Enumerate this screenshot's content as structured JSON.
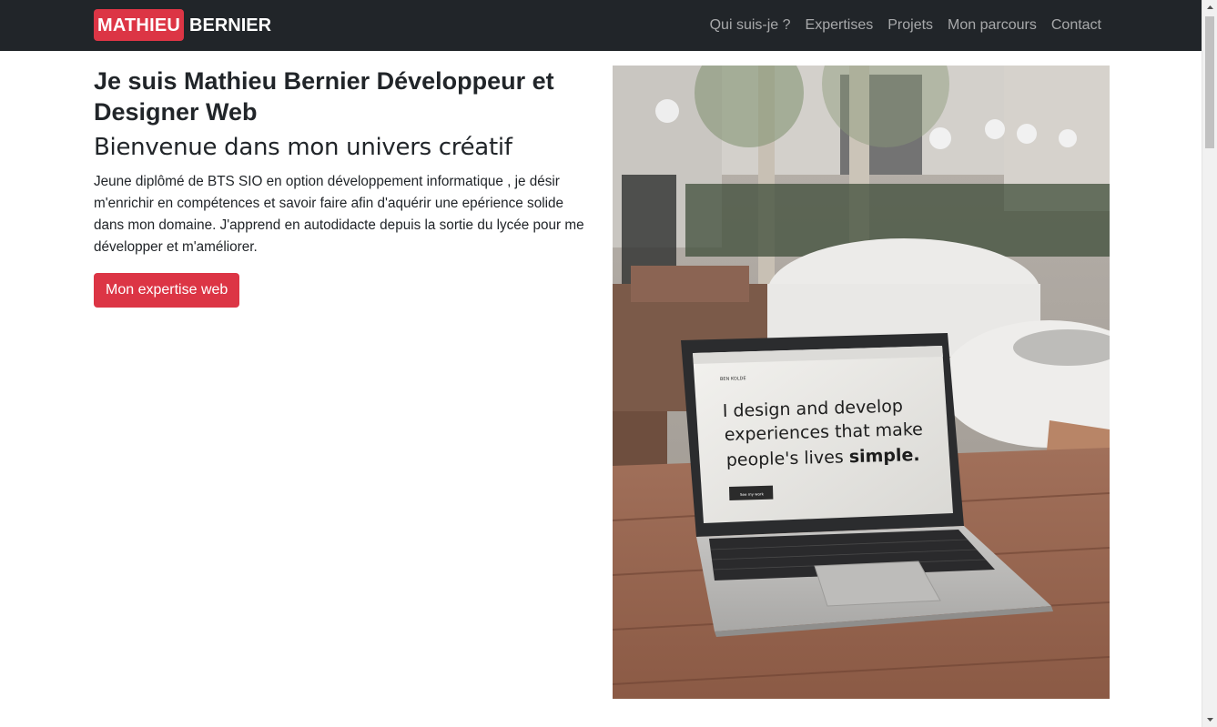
{
  "navbar": {
    "brand_first": "MATHIEU",
    "brand_last": "BERNIER",
    "links": [
      {
        "label": "Qui suis-je ?"
      },
      {
        "label": "Expertises"
      },
      {
        "label": "Projets"
      },
      {
        "label": "Mon parcours"
      },
      {
        "label": "Contact"
      }
    ]
  },
  "hero": {
    "title": "Je suis Mathieu Bernier Développeur et Designer Web",
    "subtitle": "Bienvenue dans mon univers créatif",
    "description": "Jeune diplômé de BTS SIO en option développement informatique , je désir m'enrichir en compétences et savoir faire afin d'aquérir une epérience solide dans mon domaine. J'apprend en autodidacte depuis la sortie du lycée pour me développer et m'améliorer.",
    "button_label": "Mon expertise web"
  },
  "image": {
    "screen_line1": "I design and develop",
    "screen_line2": "experiences that make",
    "screen_line3a": "people's lives ",
    "screen_line3b": "simple.",
    "screen_logo": "BEN KOLDE",
    "screen_button": "See my work"
  },
  "colors": {
    "navbar_bg": "#212529",
    "accent": "#dc3545"
  }
}
